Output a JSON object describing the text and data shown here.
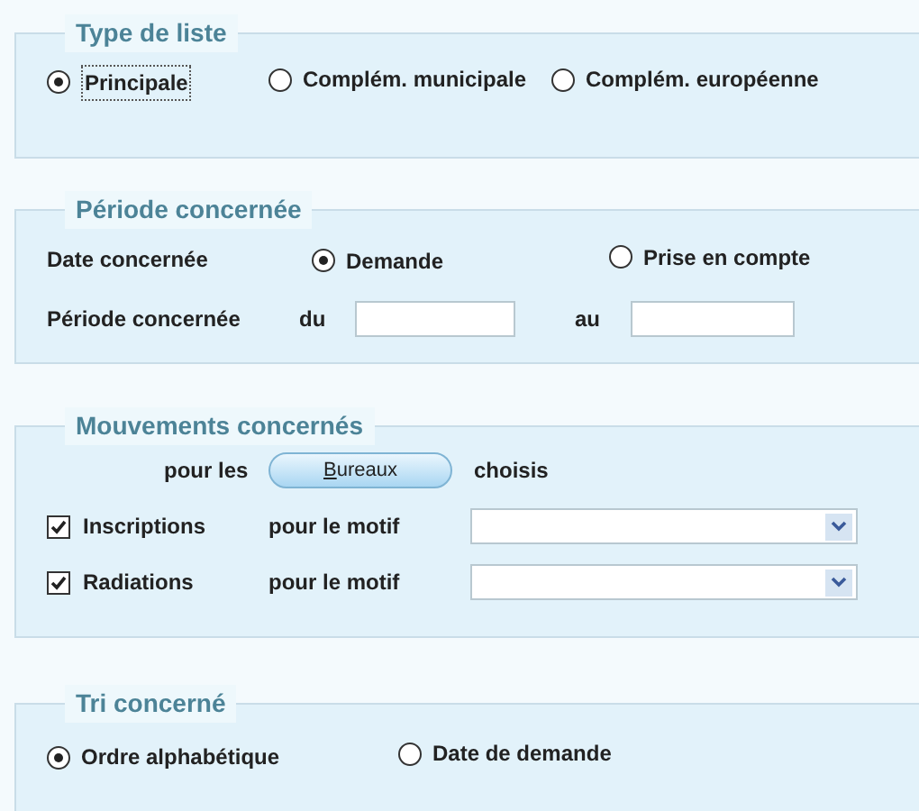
{
  "type_liste": {
    "title": "Type de liste",
    "options": [
      {
        "label": "Principale",
        "selected": true
      },
      {
        "label": "Complém. municipale",
        "selected": false
      },
      {
        "label": "Complém. européenne",
        "selected": false
      }
    ]
  },
  "periode": {
    "title": "Période concernée",
    "date_label": "Date concernée",
    "date_options": [
      {
        "label": "Demande",
        "selected": true
      },
      {
        "label": "Prise en compte",
        "selected": false
      }
    ],
    "period_label": "Période concernée",
    "from_label": "du",
    "to_label": "au"
  },
  "mouvements": {
    "title": "Mouvements concernés",
    "prefix": "pour les",
    "button": "Bureaux",
    "suffix": "choisis",
    "rows": [
      {
        "label": "Inscriptions",
        "checked": true,
        "motif_label": "pour le motif"
      },
      {
        "label": "Radiations",
        "checked": true,
        "motif_label": "pour le motif"
      }
    ]
  },
  "tri": {
    "title": "Tri concerné",
    "options": [
      {
        "label": "Ordre alphabétique",
        "selected": true
      },
      {
        "label": "Date de demande",
        "selected": false
      }
    ]
  }
}
